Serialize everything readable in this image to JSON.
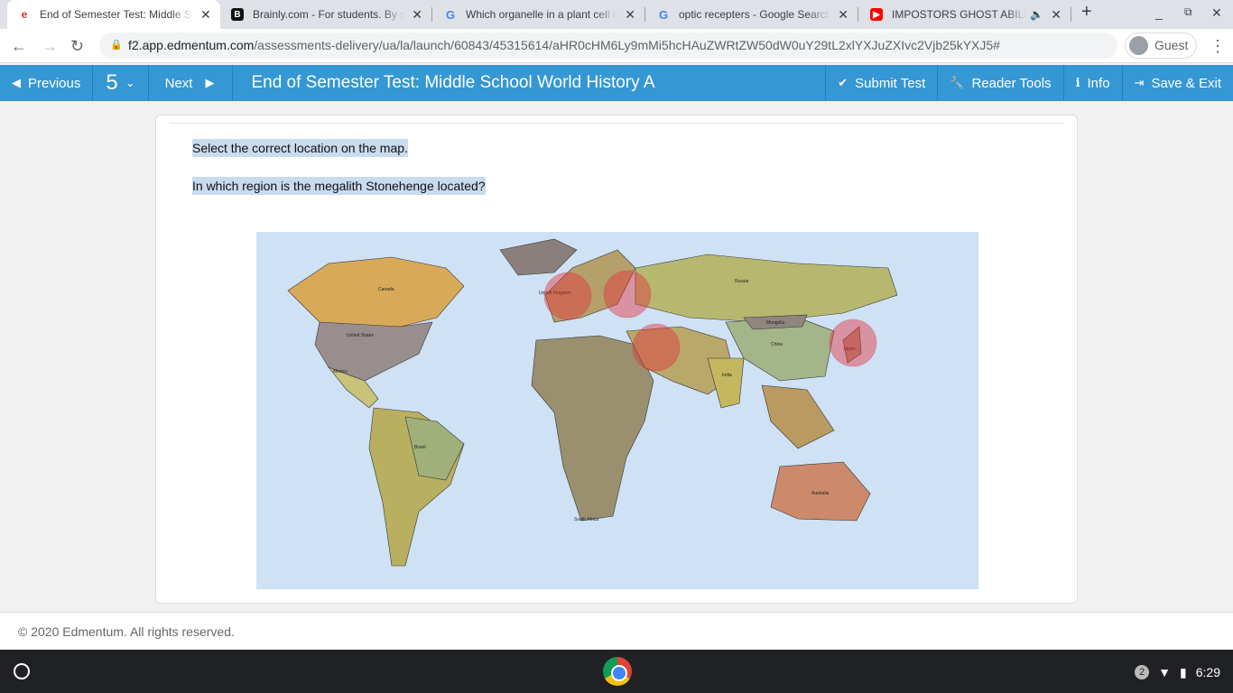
{
  "browser": {
    "tabs": [
      {
        "title": "End of Semester Test: Middle School World History A",
        "icon": "edmentum-icon",
        "active": true
      },
      {
        "title": "Brainly.com - For students. By students.",
        "icon": "brainly-icon"
      },
      {
        "title": "Which organelle in a plant cell is",
        "icon": "google-icon"
      },
      {
        "title": "optic recepters - Google Search",
        "icon": "google-icon"
      },
      {
        "title": "IMPOSTORS GHOST ABILITY",
        "icon": "youtube-icon",
        "audio": true
      }
    ],
    "new_tab": "+",
    "url_host": "f2.app.edmentum.com",
    "url_path": "/assessments-delivery/ua/la/launch/60843/45315614/aHR0cHM6Ly9mMi5hcHAuZWRtZW50dW0uY29tL2xlYXJuZXIvc2Vjb25kYXJ5#",
    "profile": "Guest"
  },
  "toolbar": {
    "previous": "Previous",
    "question_number": "5",
    "next": "Next",
    "title": "End of Semester Test: Middle School World History A",
    "submit": "Submit Test",
    "reader_tools": "Reader Tools",
    "info": "Info",
    "save_exit": "Save & Exit",
    "color": "#3597d3"
  },
  "question": {
    "instruction": "Select the correct location on the map.",
    "prompt": "In which region is the megalith Stonehenge located?",
    "map_labels": {
      "canada": "Canada",
      "us": "United States",
      "mexico": "Mexico",
      "brazil": "Brazil",
      "russia": "Russia",
      "china": "China",
      "india": "India",
      "australia": "Australia",
      "south_africa": "South Africa",
      "mongolia": "Mongolia",
      "uk": "United Kingdom",
      "japan": "Japan"
    },
    "hotspots": [
      "Western Europe (United Kingdom, France)",
      "Eastern Europe",
      "Middle East",
      "Japan"
    ]
  },
  "footer": {
    "copyright": "© 2020 Edmentum. All rights reserved."
  },
  "shelf": {
    "notifications": "2",
    "time": "6:29"
  }
}
